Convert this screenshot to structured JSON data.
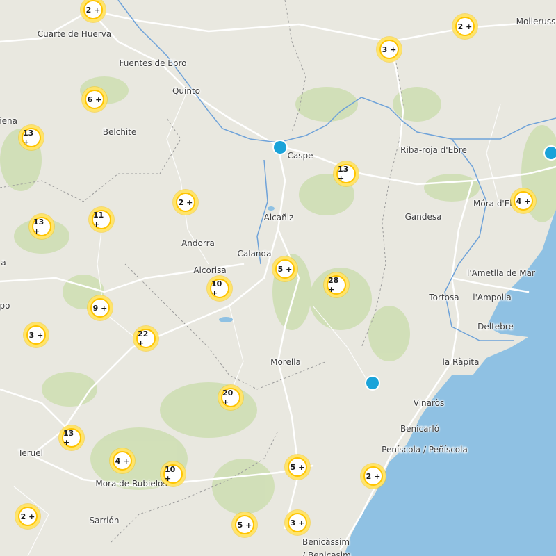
{
  "colors": {
    "land": "#e9e8e0",
    "sea": "#8fc1e3",
    "vegetation": "#cfdfb4",
    "road": "#ffffff",
    "river": "#6ea2d9",
    "border": "#9b9b9b",
    "cluster_fill": "#ffe46a",
    "cluster_ring": "#ffc400",
    "marker": "#1aa3d9"
  },
  "places": [
    {
      "name": "Cuarte de Huerva"
    },
    {
      "name": "Molleruss"
    },
    {
      "name": "Fuentes de Ebro"
    },
    {
      "name": "Quinto"
    },
    {
      "name": "ñena"
    },
    {
      "name": "Belchite"
    },
    {
      "name": "Caspe"
    },
    {
      "name": "Riba-roja d'Ebre"
    },
    {
      "name": "Móra d'Ebre"
    },
    {
      "name": "Gandesa"
    },
    {
      "name": "Alcañiz"
    },
    {
      "name": "Andorra"
    },
    {
      "name": "Calanda"
    },
    {
      "name": "Alcorisa"
    },
    {
      "name": "l'Ametlla de Mar"
    },
    {
      "name": "Tortosa"
    },
    {
      "name": "l'Ampolla"
    },
    {
      "name": "Deltebre"
    },
    {
      "name": "a"
    },
    {
      "name": "po"
    },
    {
      "name": "Morella"
    },
    {
      "name": "la Ràpita"
    },
    {
      "name": "Vinaròs"
    },
    {
      "name": "Benicarló"
    },
    {
      "name": "Peníscola / Peñíscola"
    },
    {
      "name": "Teruel"
    },
    {
      "name": "Mora de Rubielos"
    },
    {
      "name": "Sarrión"
    },
    {
      "name": "Benicàssim"
    },
    {
      "name": "/ Benicasim"
    }
  ],
  "clusters": [
    {
      "count": "2 +"
    },
    {
      "count": "2 +"
    },
    {
      "count": "3 +"
    },
    {
      "count": "6 +"
    },
    {
      "count": "13 +"
    },
    {
      "count": "13 +"
    },
    {
      "count": "4 +"
    },
    {
      "count": "2 +"
    },
    {
      "count": "11 +"
    },
    {
      "count": "13 +"
    },
    {
      "count": "5 +"
    },
    {
      "count": "28 +"
    },
    {
      "count": "10 +"
    },
    {
      "count": "9 +"
    },
    {
      "count": "3 +"
    },
    {
      "count": "22 +"
    },
    {
      "count": "20 +"
    },
    {
      "count": "13 +"
    },
    {
      "count": "4 +"
    },
    {
      "count": "10 +"
    },
    {
      "count": "5 +"
    },
    {
      "count": "2 +"
    },
    {
      "count": "2 +"
    },
    {
      "count": "5 +"
    },
    {
      "count": "3 +"
    }
  ],
  "markers": [
    {
      "name": "marker-caspe"
    },
    {
      "name": "marker-east-edge"
    },
    {
      "name": "marker-near-vinaros"
    }
  ]
}
